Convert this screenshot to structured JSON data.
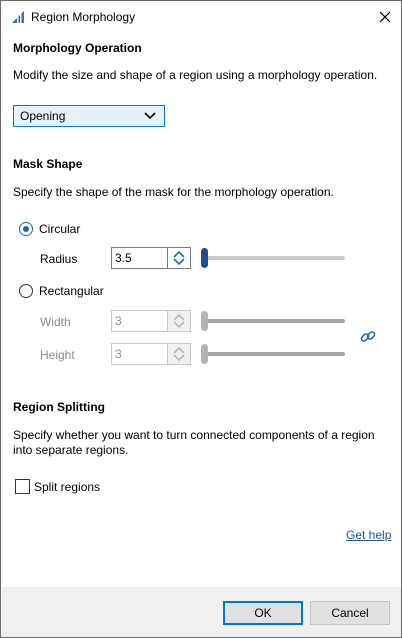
{
  "window": {
    "title": "Region Morphology"
  },
  "morphology": {
    "title": "Morphology Operation",
    "description": "Modify the size and shape of a region using a morphology operation.",
    "operation": "Opening"
  },
  "mask": {
    "title": "Mask Shape",
    "description": "Specify the shape of the mask for the morphology operation.",
    "circular_label": "Circular",
    "radius_label": "Radius",
    "radius_value": "3.5",
    "rectangular_label": "Rectangular",
    "width_label": "Width",
    "width_value": "3",
    "height_label": "Height",
    "height_value": "3",
    "selected": "circular"
  },
  "splitting": {
    "title": "Region Splitting",
    "description_line1": "Specify whether you want to turn connected components of a region",
    "description_line2": "into separate regions.",
    "split_label": "Split regions",
    "split_checked": false
  },
  "help": {
    "label": "Get help"
  },
  "buttons": {
    "ok": "OK",
    "cancel": "Cancel"
  },
  "colors": {
    "accent": "#0078d7",
    "radio_blue": "#1e63b5",
    "slider_thumb": "#1b4f8a",
    "link": "#1c55a0"
  },
  "icons": {
    "app": "region-morphology-app-icon",
    "close": "close-icon",
    "chevron": "chevron-down-icon",
    "spin": "spin-up-down-icon",
    "chain": "chain-link-icon"
  }
}
